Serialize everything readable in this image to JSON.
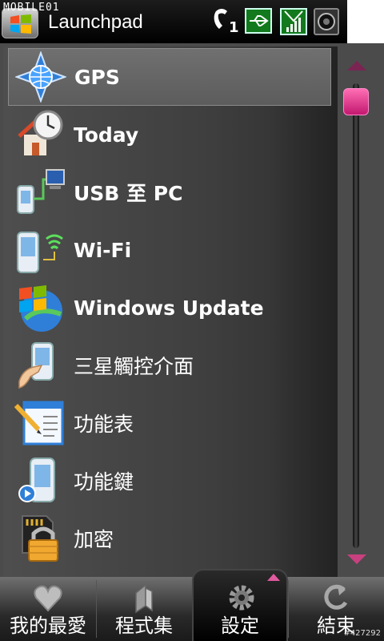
{
  "statusbar": {
    "watermark": "MOBILE01",
    "app_title": "Launchpad",
    "missed_calls": "1",
    "icons": [
      "phone-icon",
      "usb-connection-icon",
      "signal-icon",
      "volume-icon"
    ]
  },
  "menu": {
    "items": [
      {
        "label": "GPS",
        "icon": "gps-compass-icon",
        "bold": true,
        "selected": true
      },
      {
        "label": "Today",
        "icon": "today-house-clock-icon",
        "bold": true
      },
      {
        "label": "USB 至 PC",
        "icon": "usb-to-pc-icon",
        "bold": true
      },
      {
        "label": "Wi-Fi",
        "icon": "wifi-device-icon",
        "bold": true
      },
      {
        "label": "Windows Update",
        "icon": "windows-update-icon",
        "bold": true
      },
      {
        "label": "三星觸控介面",
        "icon": "touch-interface-icon",
        "bold": false
      },
      {
        "label": "功能表",
        "icon": "menu-document-icon",
        "bold": false
      },
      {
        "label": "功能鍵",
        "icon": "function-key-device-icon",
        "bold": false
      },
      {
        "label": "加密",
        "icon": "encryption-lock-icon",
        "bold": false
      }
    ]
  },
  "tabs": [
    {
      "label": "我的最愛",
      "icon": "heart-icon",
      "active": false
    },
    {
      "label": "程式集",
      "icon": "programs-icon",
      "active": false
    },
    {
      "label": "設定",
      "icon": "gear-icon",
      "active": true
    },
    {
      "label": "結束",
      "icon": "exit-arrow-icon",
      "active": false
    }
  ],
  "build_id": "#427292",
  "colors": {
    "accent": "#d63a8a",
    "background": "#000000",
    "list_bg": "#444444",
    "status_icon_green": "#127a1d"
  }
}
